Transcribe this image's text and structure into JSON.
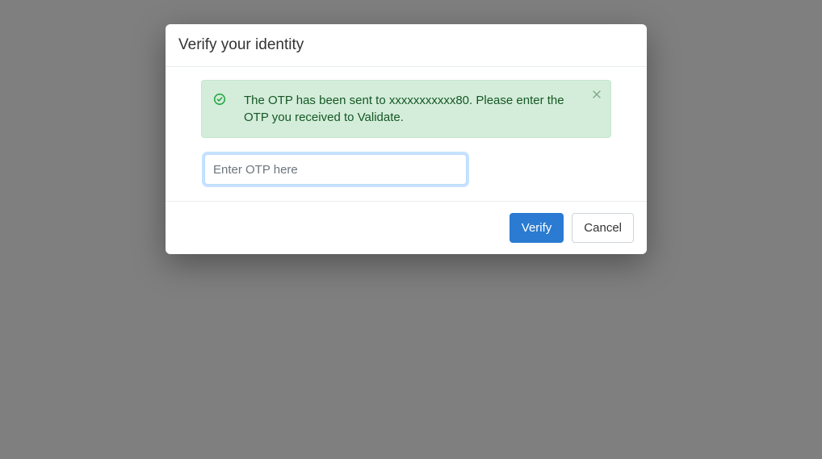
{
  "modal": {
    "title": "Verify your identity",
    "alert": {
      "message": "The OTP has been sent to xxxxxxxxxxx80. Please enter the OTP you received to Validate."
    },
    "otp": {
      "placeholder": "Enter OTP here",
      "value": ""
    },
    "buttons": {
      "verify": "Verify",
      "cancel": "Cancel"
    }
  }
}
